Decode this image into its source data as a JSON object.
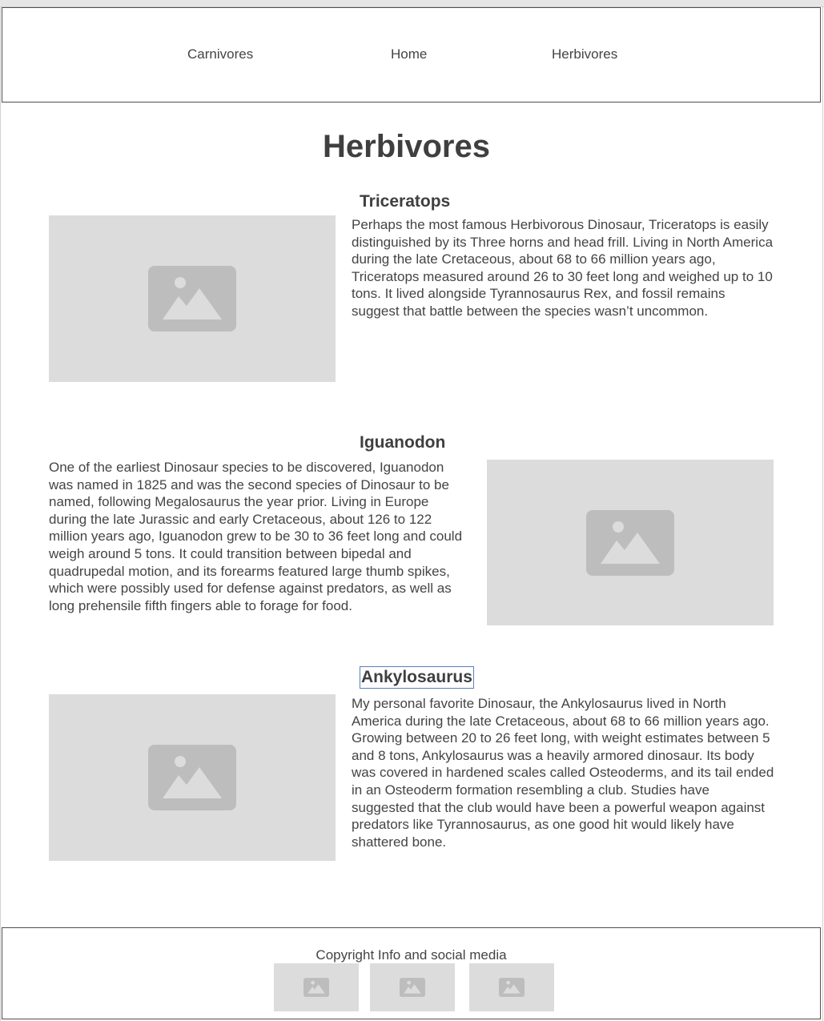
{
  "nav": {
    "carnivores": "Carnivores",
    "home": "Home",
    "herbivores": "Herbivores"
  },
  "page": {
    "title": "Herbivores"
  },
  "sections": [
    {
      "title": "Triceratops",
      "text": "Perhaps the most famous Herbivorous Dinosaur, Triceratops is easily distinguished by its Three horns and head frill. Living in North America during the late Cretaceous, about 68 to 66 million years ago, Triceratops measured around 26 to 30 feet long and weighed up to 10 tons. It lived alongside Tyrannosaurus Rex, and fossil remains suggest that battle between the species wasn’t uncommon.",
      "image_icon": "image-placeholder-icon"
    },
    {
      "title": "Iguanodon",
      "text": "One of the earliest Dinosaur species to be discovered, Iguanodon was named in 1825 and was the second species of Dinosaur to be named, following Megalosaurus the year prior. Living in Europe during the late Jurassic and early Cretaceous, about 126 to 122 million years ago, Iguanodon grew to be 30 to 36 feet long and could weigh around 5 tons. It could transition between bipedal and quadrupedal motion, and its forearms featured large thumb spikes, which were possibly used for defense against predators, as well as long prehensile fifth fingers able to forage for food.",
      "image_icon": "image-placeholder-icon"
    },
    {
      "title": "Ankylosaurus",
      "text": "My personal favorite Dinosaur, the Ankylosaurus lived in North America during the late Cretaceous, about 68 to 66 million years ago. Growing between 20 to 26 feet long, with weight estimates between 5 and 8 tons, Ankylosaurus was a heavily armored dinosaur. Its body was covered in hardened scales called Osteoderms, and its tail ended in an Osteoderm formation resembling a club. Studies have suggested that the club would have been a powerful weapon against predators like Tyrannosaurus, as one good hit would likely have shattered bone.",
      "image_icon": "image-placeholder-icon"
    }
  ],
  "footer": {
    "text": "Copyright Info and social media",
    "social_icons": [
      "image-placeholder-icon",
      "image-placeholder-icon",
      "image-placeholder-icon"
    ]
  },
  "colors": {
    "placeholder_bg": "#dcdcdc",
    "placeholder_icon": "#bdbdbd",
    "text": "#444444",
    "border": "#4f4f4f",
    "selection": "#5a7fc0"
  }
}
